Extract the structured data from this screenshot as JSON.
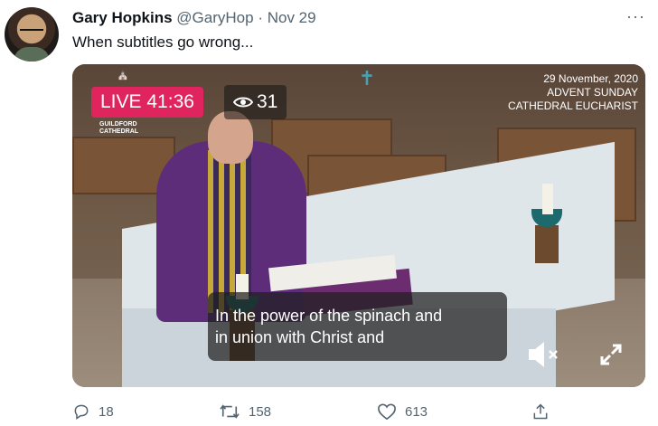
{
  "tweet": {
    "author_name": "Gary Hopkins",
    "handle": "@GaryHop",
    "separator": "·",
    "date": "Nov 29",
    "more": "···",
    "text": "When subtitles go wrong..."
  },
  "video": {
    "live_label": "LIVE",
    "live_time": "41:36",
    "viewer_count": "31",
    "logo_lines": [
      "GUILDFORD",
      "CATHEDRAL"
    ],
    "info_lines": [
      "29 November, 2020",
      "ADVENT SUNDAY",
      "CATHEDRAL EUCHARIST"
    ],
    "subtitle_lines": [
      "In the power of the spinach and",
      "in union with Christ and"
    ],
    "live_color": "#e0245e"
  },
  "actions": {
    "reply_count": "18",
    "retweet_count": "158",
    "like_count": "613"
  },
  "icons": {
    "reply": "reply-icon",
    "retweet": "retweet-icon",
    "like": "heart-icon",
    "share": "share-icon",
    "mute": "mute-icon",
    "fullscreen": "fullscreen-icon",
    "views": "eye-icon"
  }
}
